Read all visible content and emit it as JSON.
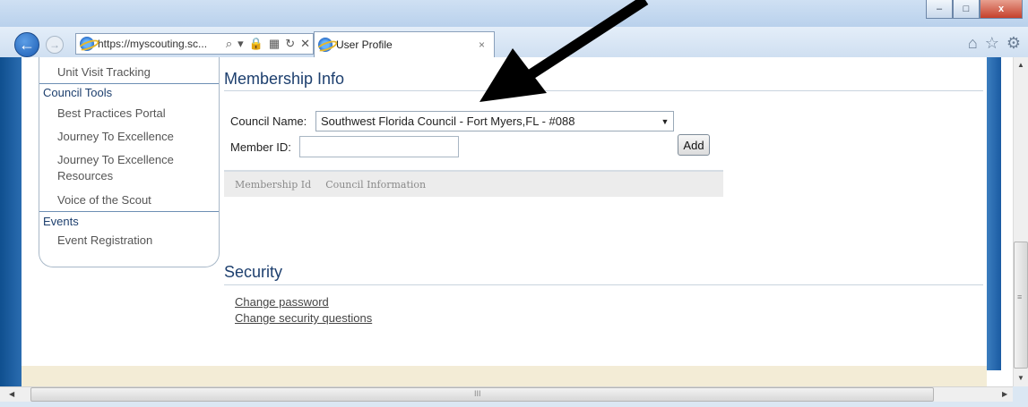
{
  "browser": {
    "url": "https://myscouting.sc...",
    "tab_title": "User Profile",
    "tab_close": "×",
    "back": "←",
    "forward": "→",
    "address_icons": [
      "search-icon",
      "dropdown-icon",
      "lock-icon",
      "compat-icon",
      "refresh-icon",
      "stop-icon"
    ],
    "window_controls": {
      "minimize": "–",
      "maximize": "□",
      "close": "x"
    },
    "right_icons": [
      "home-icon",
      "star-icon",
      "gear-icon"
    ]
  },
  "sidebar": {
    "top_item": "Unit Visit Tracking",
    "groups": [
      {
        "title": "Council Tools",
        "items": [
          "Best Practices Portal",
          "Journey To Excellence",
          "Journey To Excellence Resources",
          "Voice of the Scout"
        ]
      },
      {
        "title": "Events",
        "items": [
          "Event Registration"
        ]
      }
    ]
  },
  "membership": {
    "title": "Membership Info",
    "council_label": "Council Name:",
    "council_value": "Southwest Florida Council - Fort Myers,FL - #088",
    "member_id_label": "Member ID:",
    "member_id_value": "",
    "add_label": "Add",
    "table_headers": [
      "Membership Id",
      "Council Information"
    ]
  },
  "security": {
    "title": "Security",
    "links": [
      "Change password",
      "Change security questions"
    ]
  },
  "scrollbar": {
    "h_marker": "III",
    "v_marker": "≡"
  },
  "colors": {
    "accent": "#1d3f6e",
    "band": "#1a5ba2",
    "footer": "#f3ecd6"
  }
}
